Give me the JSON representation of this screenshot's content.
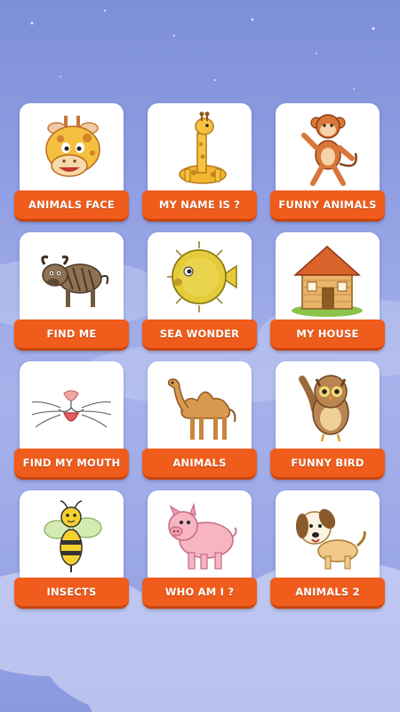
{
  "menu": {
    "cards": [
      {
        "label": "ANIMALS FACE",
        "icon": "giraffe-face-icon"
      },
      {
        "label": "MY NAME IS ?",
        "icon": "giraffe-toy-icon"
      },
      {
        "label": "FUNNY ANIMALS",
        "icon": "monkey-icon"
      },
      {
        "label": "FIND ME",
        "icon": "wildebeest-icon"
      },
      {
        "label": "SEA WONDER",
        "icon": "pufferfish-icon"
      },
      {
        "label": "MY HOUSE",
        "icon": "house-icon"
      },
      {
        "label": "FIND MY MOUTH",
        "icon": "mouth-whiskers-icon"
      },
      {
        "label": "ANIMALS",
        "icon": "camel-icon"
      },
      {
        "label": "FUNNY BIRD",
        "icon": "owl-icon"
      },
      {
        "label": "INSECTS",
        "icon": "bee-icon"
      },
      {
        "label": "WHO AM I ?",
        "icon": "pig-icon"
      },
      {
        "label": "ANIMALS 2",
        "icon": "puppy-icon"
      }
    ]
  },
  "colors": {
    "banner": "#ef5c1b",
    "card": "#ffffff",
    "background": "#8f9ee3"
  }
}
